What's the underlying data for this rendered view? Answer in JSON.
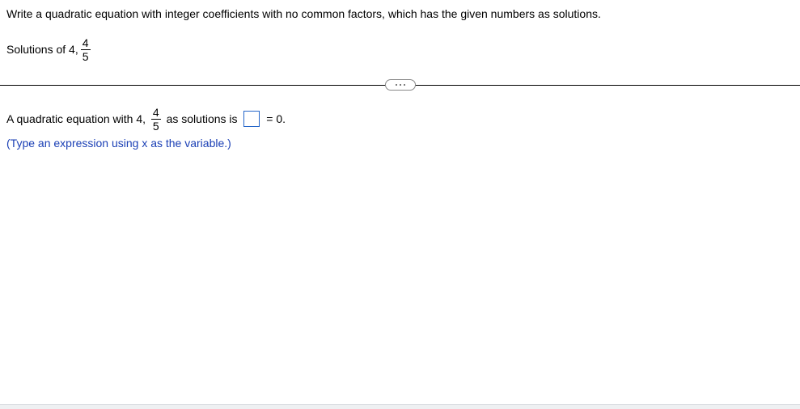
{
  "question": {
    "prompt": "Write a quadratic equation with integer coefficients with no common factors, which has the given numbers as solutions.",
    "solutions_label": "Solutions of 4, ",
    "fraction_num": "4",
    "fraction_den": "5"
  },
  "answer": {
    "lead_text": "A quadratic equation with 4, ",
    "fraction_num": "4",
    "fraction_den": "5",
    "mid_text": " as solutions is ",
    "tail_text": " = 0.",
    "input_value": ""
  },
  "hint": "(Type an expression using x as the variable.)"
}
